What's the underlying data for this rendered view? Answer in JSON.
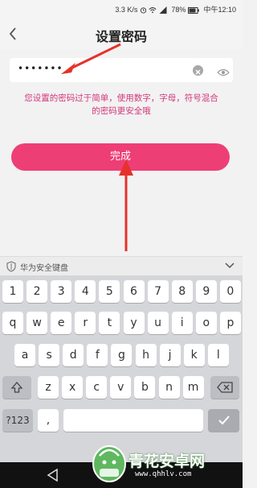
{
  "status_bar": {
    "speed": "3.3 K/s",
    "battery": "78%",
    "time": "中午12:10"
  },
  "header": {
    "title": "设置密码"
  },
  "password": {
    "value": "•••••••"
  },
  "hint": "您设置的密码过于简单，使用数字，字母，符号混合的密码更安全哦",
  "done_button": "完成",
  "keyboard": {
    "name": "华为安全键盘",
    "row1": [
      "1",
      "2",
      "3",
      "4",
      "5",
      "6",
      "7",
      "8",
      "9",
      "0"
    ],
    "row2": [
      "q",
      "w",
      "e",
      "r",
      "t",
      "y",
      "u",
      "i",
      "o",
      "p"
    ],
    "row3": [
      "a",
      "s",
      "d",
      "f",
      "g",
      "h",
      "j",
      "k",
      "l"
    ],
    "row4": [
      "z",
      "x",
      "c",
      "v",
      "b",
      "n",
      "m"
    ],
    "mode_key": "?123",
    "comma_key": ","
  },
  "watermark": {
    "text": "青花安卓网",
    "url": "www.qhhlv.com"
  },
  "colors": {
    "accent": "#ee3e76",
    "hint": "#d3367b"
  }
}
